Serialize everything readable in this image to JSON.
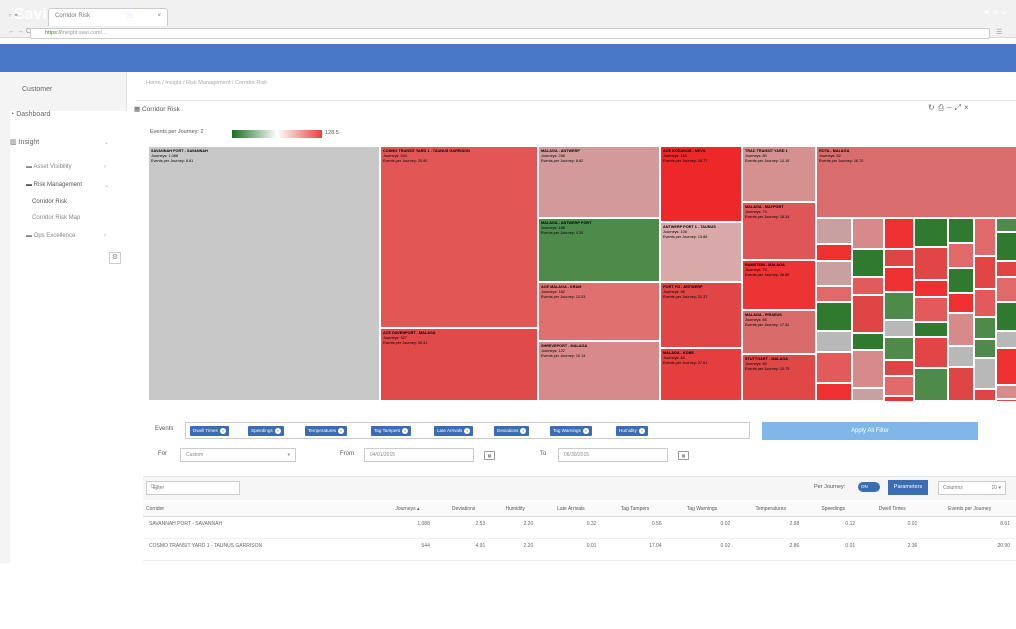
{
  "browser": {
    "tab_title": "Corridor Risk",
    "url_secure": "https://",
    "url_host": "insight.savi.com",
    "url_rest": "/..."
  },
  "app": {
    "brand": "Savi",
    "logo_text": "Savi"
  },
  "breadcrumb": "Home / Insight / Risk Management / Corridor Risk",
  "sidebar": {
    "title": "Customer",
    "dashboard": "Dashboard",
    "insight": "Insight",
    "items": [
      "Asset Visibility",
      "Risk Management",
      "Corridor Risk",
      "Corridor Risk Map",
      "Ops Excellence"
    ]
  },
  "panel": {
    "title": "Corridor Risk"
  },
  "legend": {
    "label": "Events per Journey:",
    "min": "2",
    "max": "128.5"
  },
  "treemap": {
    "journeys_label": "Journeys:",
    "events_label": "Events per Journey:",
    "cells": [
      {
        "name": "SAVANNAH PORT - SAVANNAH",
        "j": "1,088",
        "e": "8.61",
        "c": "#c8c8c8"
      },
      {
        "name": "COSMO TRANSIT YARD 1 - TAUNUS GARRISON",
        "j": "544",
        "e": "20.90",
        "c": "#e35656"
      },
      {
        "name": "ACE DAVENPORT - MALAGA",
        "j": "327",
        "e": "30.41",
        "c": "#e04a4a"
      },
      {
        "name": "MALAGA - ANTWERP",
        "j": "256",
        "e": "8.62",
        "c": "#d29a9a"
      },
      {
        "name": "MALAGA - ANTWERP PORT",
        "j": "188",
        "e": "4.20",
        "c": "#4e8a4a"
      },
      {
        "name": "ACE MALAGA - KRAM",
        "j": "162",
        "e": "12.03",
        "c": "#e07070"
      },
      {
        "name": "SHREVEPORT - MALAGA",
        "j": "122",
        "e": "10.14",
        "c": "#d88a8a"
      },
      {
        "name": "ACE KODAKOS - NEVIL",
        "j": "118",
        "e": "18.77",
        "c": "#ee2828"
      },
      {
        "name": "ANTWERP PORT 1 - TAUNUS",
        "j": "108",
        "e": "13.86",
        "c": "#d9a9a9"
      },
      {
        "name": "PORT PO - ANTWERP",
        "j": "96",
        "e": "21.37",
        "c": "#e04646"
      },
      {
        "name": "MALAGA - KOBE",
        "j": "84",
        "e": "27.61",
        "c": "#e63e3e"
      },
      {
        "name": "TRAC TRANSIT YARD 1",
        "j": "80",
        "e": "14.16",
        "c": "#d59090"
      },
      {
        "name": "MALAGA - MAYPORT",
        "j": "74",
        "e": "18.34",
        "c": "#e05555"
      },
      {
        "name": "RAMSTEIN - MALAGA",
        "j": "70",
        "e": "26.89",
        "c": "#ec3434"
      },
      {
        "name": "MALAGA - PIRAEUS",
        "j": "66",
        "e": "17.32",
        "c": "#d96b6b"
      },
      {
        "name": "STUTTGART - MALAGA",
        "j": "60",
        "e": "15.75",
        "c": "#e04848"
      },
      {
        "name": "ROTA - MALAGA",
        "j": "52",
        "e": "18.70",
        "c": "#d96c6c"
      }
    ]
  },
  "filters": {
    "events_label": "Events",
    "chips": [
      "Dwell Times",
      "Speedings",
      "Temperatures",
      "Tag Tampers",
      "Late Arrivals",
      "Deviations",
      "Tag Warnings",
      "Humidity"
    ],
    "apply": "Apply All Filter",
    "for_label": "For",
    "for_value": "Custom",
    "from_label": "From",
    "from_value": "04/01/2015",
    "to_label": "To",
    "to_value": "06/30/2015"
  },
  "table": {
    "search_placeholder": "Filter",
    "per_journey_label": "Per Journey:",
    "toggle": "ON",
    "params_button": "Parameters",
    "columns_label": "Columns",
    "columns_count": "10",
    "headers": [
      "Corridor",
      "Journeys",
      "Deviations",
      "Humidity",
      "Late Arrivals",
      "Tag Tampers",
      "Tag Warnings",
      "Temperatures",
      "Speedings",
      "Dwell Times",
      "Events per Journey"
    ],
    "rows": [
      [
        "SAVANNAH PORT - SAVANNAH",
        "1,088",
        "2.53",
        "2.20",
        "0.32",
        "0.56",
        "0.02",
        "2.98",
        "0.12",
        "0.01",
        "8.61"
      ],
      [
        "COSMO TRANSIT YARD 1 - TAUNUS GARRISON",
        "544",
        "4.91",
        "2.20",
        "0.01",
        "17.04",
        "0.02",
        "2.86",
        "0.01",
        "2.36",
        "20.90"
      ]
    ]
  }
}
